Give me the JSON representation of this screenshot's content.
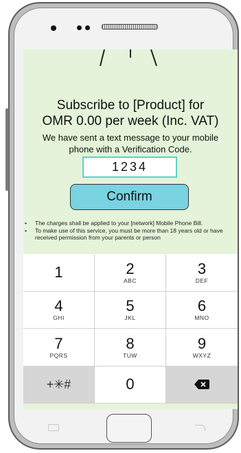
{
  "subscription": {
    "title_line1": "Subscribe to [Product] for",
    "title_line2": "OMR 0.00 per week (Inc. VAT)",
    "message_line1": "We have sent a text message to your mobile",
    "message_line2": "phone with a Verification Code.",
    "code_value": "1234",
    "confirm_label": "Confirm",
    "notes": [
      "The charges shall be applied to your [network] Mobile Phone Bill.",
      "To make use of this service, you must be more than 18 years old or have received permission from your parents or person"
    ]
  },
  "keypad": {
    "keys": [
      {
        "digit": "1",
        "letters": ""
      },
      {
        "digit": "2",
        "letters": "ABC"
      },
      {
        "digit": "3",
        "letters": "DEF"
      },
      {
        "digit": "4",
        "letters": "GHI"
      },
      {
        "digit": "5",
        "letters": "JKL"
      },
      {
        "digit": "6",
        "letters": "MNO"
      },
      {
        "digit": "7",
        "letters": "PQRS"
      },
      {
        "digit": "8",
        "letters": "TUW"
      },
      {
        "digit": "9",
        "letters": "WXYZ"
      }
    ],
    "symbols_label": "+✳#",
    "zero": "0",
    "delete_icon": "backspace-icon"
  },
  "colors": {
    "screen_bg": "#e4f3d9",
    "confirm_bg": "#79d3e0",
    "code_border": "#5bd1c9"
  }
}
